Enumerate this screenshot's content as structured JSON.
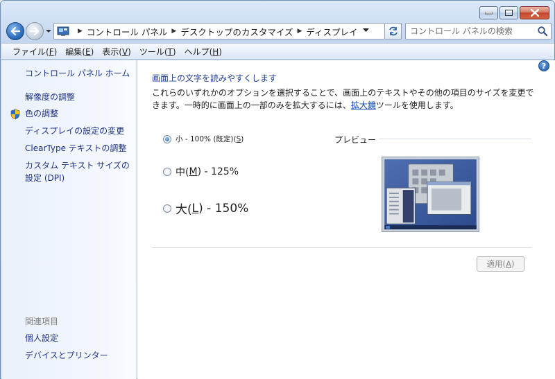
{
  "window": {
    "address_crumbs": [
      "コントロール パネル",
      "デスクトップのカスタマイズ",
      "ディスプレイ"
    ],
    "search_placeholder": "コントロール パネルの検索"
  },
  "menubar": {
    "items": [
      {
        "label": "ファイル(",
        "key": "F",
        "suffix": ")"
      },
      {
        "label": "編集(",
        "key": "E",
        "suffix": ")"
      },
      {
        "label": "表示(",
        "key": "V",
        "suffix": ")"
      },
      {
        "label": "ツール(",
        "key": "T",
        "suffix": ")"
      },
      {
        "label": "ヘルプ(",
        "key": "H",
        "suffix": ")"
      }
    ]
  },
  "sidebar": {
    "home": "コントロール パネル ホーム",
    "links": [
      "解像度の調整",
      "色の調整",
      "ディスプレイの設定の変更",
      "ClearType テキストの調整",
      "カスタム テキスト サイズの設定 (DPI)"
    ],
    "related_heading": "関連項目",
    "related_links": [
      "個人設定",
      "デバイスとプリンター"
    ]
  },
  "main": {
    "title": "画面上の文字を読みやすくします",
    "description_before": "これらのいずれかのオプションを選択することで、画面上のテキストやその他の項目のサイズを変更できます。一時的に画面上の一部のみを拡大するには、",
    "magnifier_link": "拡大鏡",
    "description_after": "ツールを使用します。",
    "options": [
      {
        "prefix": "小 - 100% (既定)(",
        "key": "S",
        "suffix": ")",
        "selected": true
      },
      {
        "prefix": "中(",
        "key": "M",
        "suffix": ") - 125%",
        "selected": false
      },
      {
        "prefix": "大(",
        "key": "L",
        "suffix": ") - 150%",
        "selected": false
      }
    ],
    "preview_label": "プレビュー",
    "apply_prefix": "適用(",
    "apply_key": "A",
    "apply_suffix": ")"
  },
  "icons": {
    "back": "back-arrow-icon",
    "forward": "forward-arrow-icon",
    "refresh": "refresh-icon",
    "search": "search-icon",
    "help": "help-icon",
    "shield": "uac-shield-icon"
  },
  "colors": {
    "link": "#1e3287",
    "title": "#1e3c96",
    "sidebar_bg": "#eaf1fb",
    "window_frame": "#c4d6ee"
  }
}
